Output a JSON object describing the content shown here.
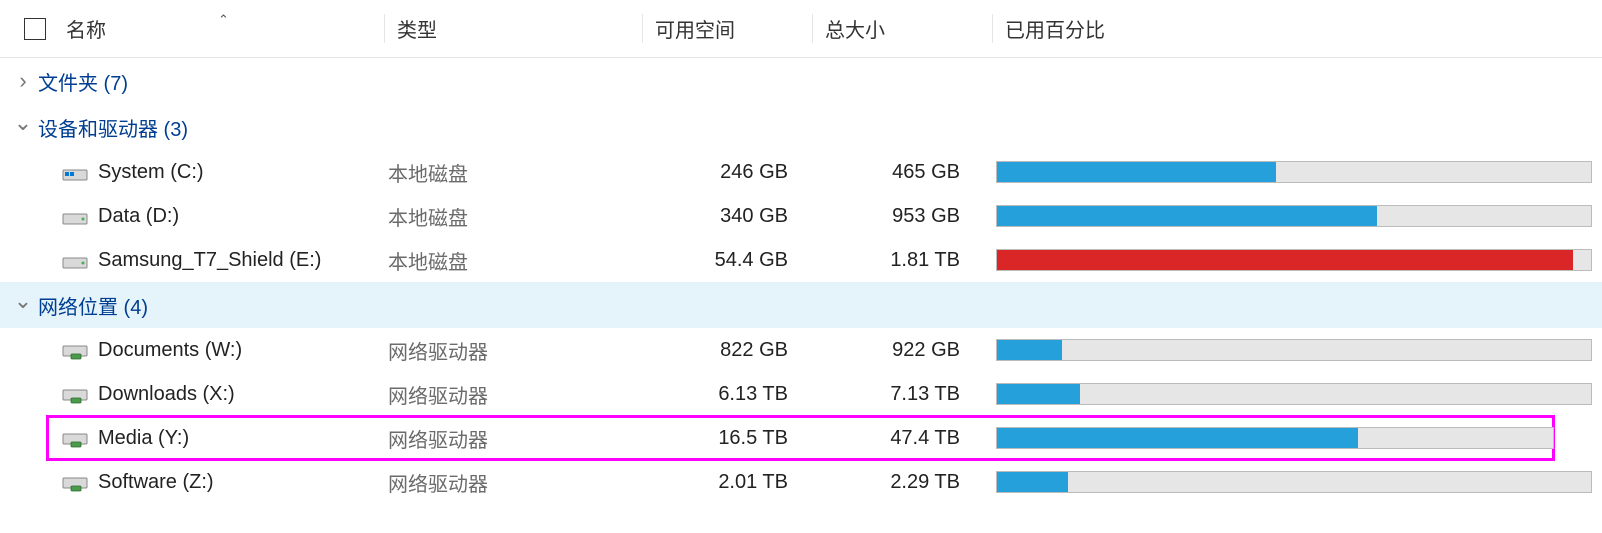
{
  "columns": {
    "name": "名称",
    "type": "类型",
    "free": "可用空间",
    "total": "总大小",
    "usage": "已用百分比"
  },
  "groups": [
    {
      "id": "folders",
      "label": "文件夹 (7)",
      "expanded": false,
      "items": []
    },
    {
      "id": "devices",
      "label": "设备和驱动器 (3)",
      "expanded": true,
      "items": [
        {
          "icon": "system",
          "name": "System (C:)",
          "type": "本地磁盘",
          "free": "246 GB",
          "total": "465 GB",
          "pct": 47,
          "color": "blue"
        },
        {
          "icon": "local",
          "name": "Data (D:)",
          "type": "本地磁盘",
          "free": "340 GB",
          "total": "953 GB",
          "pct": 64,
          "color": "blue"
        },
        {
          "icon": "local",
          "name": "Samsung_T7_Shield (E:)",
          "type": "本地磁盘",
          "free": "54.4 GB",
          "total": "1.81 TB",
          "pct": 97,
          "color": "red"
        }
      ]
    },
    {
      "id": "network",
      "label": "网络位置 (4)",
      "expanded": true,
      "highlighted": true,
      "items": [
        {
          "icon": "net",
          "name": "Documents (W:)",
          "type": "网络驱动器",
          "free": "822 GB",
          "total": "922 GB",
          "pct": 11,
          "color": "blue"
        },
        {
          "icon": "net",
          "name": "Downloads (X:)",
          "type": "网络驱动器",
          "free": "6.13 TB",
          "total": "7.13 TB",
          "pct": 14,
          "color": "blue"
        },
        {
          "icon": "net",
          "name": "Media (Y:)",
          "type": "网络驱动器",
          "free": "16.5 TB",
          "total": "47.4 TB",
          "pct": 65,
          "color": "blue",
          "selected": true
        },
        {
          "icon": "net",
          "name": "Software (Z:)",
          "type": "网络驱动器",
          "free": "2.01 TB",
          "total": "2.29 TB",
          "pct": 12,
          "color": "blue"
        }
      ]
    }
  ]
}
